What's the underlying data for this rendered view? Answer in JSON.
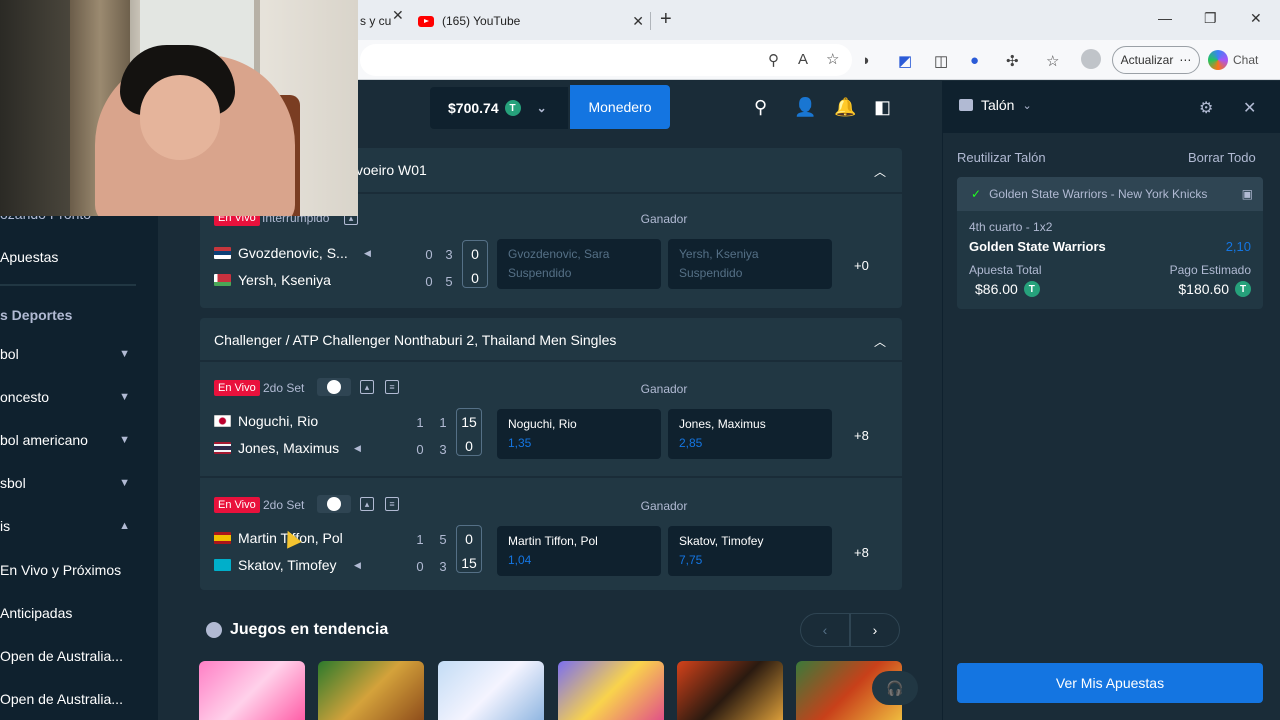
{
  "browser": {
    "tabs": [
      {
        "label": "s y cu"
      },
      {
        "label": "(165) YouTube"
      }
    ],
    "update_label": "Actualizar",
    "chat_label": "Chat"
  },
  "header": {
    "balance": "$700.74",
    "wallet_label": "Monedero"
  },
  "sidebar": {
    "items": [
      {
        "label": "ozando Pronto"
      },
      {
        "label": "Apuestas"
      },
      {
        "label": "s Deportes"
      },
      {
        "label": "bol"
      },
      {
        "label": "oncesto"
      },
      {
        "label": "bol americano"
      },
      {
        "label": "sbol"
      },
      {
        "label": "is"
      },
      {
        "label": "En Vivo y Próximos"
      },
      {
        "label": "Anticipadas"
      },
      {
        "label": "Open de Australia..."
      },
      {
        "label": "Open de Australia..."
      }
    ]
  },
  "events": [
    {
      "title": "voeiro W01",
      "matches": [
        {
          "live": "En Vivo",
          "status": "Interrumpido",
          "market": "Ganador",
          "players": [
            {
              "name": "Gvozdenovic, S...",
              "sets": [
                "0",
                "3"
              ],
              "point": "0"
            },
            {
              "name": "Yersh, Kseniya",
              "sets": [
                "0",
                "5"
              ],
              "point": "0"
            }
          ],
          "odds": [
            {
              "name": "Gvozdenovic, Sara",
              "value": "Suspendido"
            },
            {
              "name": "Yersh, Kseniya",
              "value": "Suspendido"
            }
          ],
          "more": "+0"
        }
      ]
    },
    {
      "title": "Challenger / ATP Challenger Nonthaburi 2, Thailand Men Singles",
      "matches": [
        {
          "live": "En Vivo",
          "status": "2do Set",
          "market": "Ganador",
          "players": [
            {
              "name": "Noguchi, Rio",
              "sets": [
                "1",
                "1"
              ],
              "point": "15"
            },
            {
              "name": "Jones, Maximus",
              "sets": [
                "0",
                "3"
              ],
              "point": "0"
            }
          ],
          "odds": [
            {
              "name": "Noguchi, Rio",
              "value": "1,35"
            },
            {
              "name": "Jones, Maximus",
              "value": "2,85"
            }
          ],
          "more": "+8"
        },
        {
          "live": "En Vivo",
          "status": "2do Set",
          "market": "Ganador",
          "players": [
            {
              "name": "Martin Tiffon, Pol",
              "sets": [
                "1",
                "5"
              ],
              "point": "0"
            },
            {
              "name": "Skatov, Timofey",
              "sets": [
                "0",
                "3"
              ],
              "point": "15"
            }
          ],
          "odds": [
            {
              "name": "Martin Tiffon, Pol",
              "value": "1,04"
            },
            {
              "name": "Skatov, Timofey",
              "value": "7,75"
            }
          ],
          "more": "+8"
        }
      ]
    }
  ],
  "trending": {
    "title": "Juegos en tendencia"
  },
  "betslip": {
    "title": "Talón",
    "reuse_label": "Reutilizar Talón",
    "clear_label": "Borrar Todo",
    "bet": {
      "event": "Golden State Warriors - New York Knicks",
      "market": "4th cuarto - 1x2",
      "selection": "Golden State Warriors",
      "odds": "2,10",
      "stake_label": "Apuesta Total",
      "stake": "$86.00",
      "payout_label": "Pago Estimado",
      "payout": "$180.60"
    },
    "view_bets_label": "Ver Mis Apuestas"
  },
  "colors": {
    "accent": "#1475e1",
    "live": "#e9113c",
    "panel": "#213743",
    "background": "#1a2c38"
  }
}
